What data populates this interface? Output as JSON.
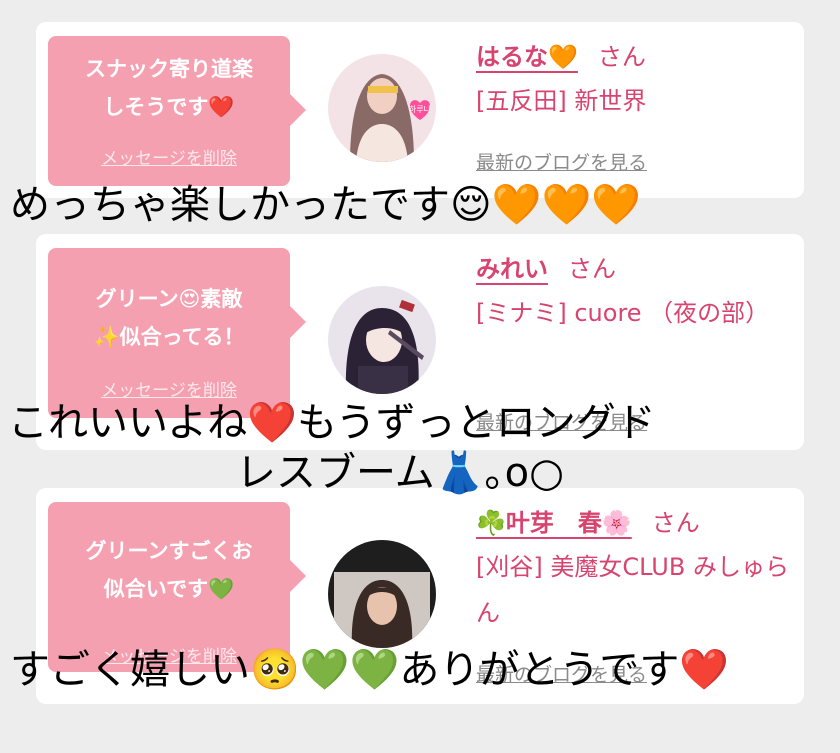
{
  "messages": [
    {
      "bubble_text": "スナック寄り道楽\nしそうです❤️",
      "delete_label": "メッセージを削除",
      "name": "はるな🧡",
      "honorific": "さん",
      "shop": "[五反田] 新世界",
      "blog_link": "最新のブログを見る",
      "avatar_text": "하루나"
    },
    {
      "bubble_text": "グリーン😍素敵\n✨似合ってる！",
      "delete_label": "メッセージを削除",
      "name": "みれい",
      "honorific": "さん",
      "shop": "[ミナミ] cuore （夜の部）",
      "blog_link": "最新のブログを見る"
    },
    {
      "bubble_text": "グリーンすごくお\n似合いです💚",
      "delete_label": "メッセージを削除",
      "name": "☘️叶芽　春🌸",
      "honorific": "さん",
      "shop": "[刈谷] 美魔女CLUB みしゅらん",
      "blog_link": "最新のブログを見る"
    }
  ],
  "overlay_captions": [
    "めっちゃ楽しかったです😌🧡🧡🧡",
    "これいいよね❤️もうずっとロングド",
    "レスブーム👗｡o○",
    "すごく嬉しい🥺💚💚ありがとうです❤️"
  ],
  "colors": {
    "background": "#ededed",
    "bubble": "#f5a0b0",
    "name": "#d84470",
    "link": "#8a8a8a"
  }
}
